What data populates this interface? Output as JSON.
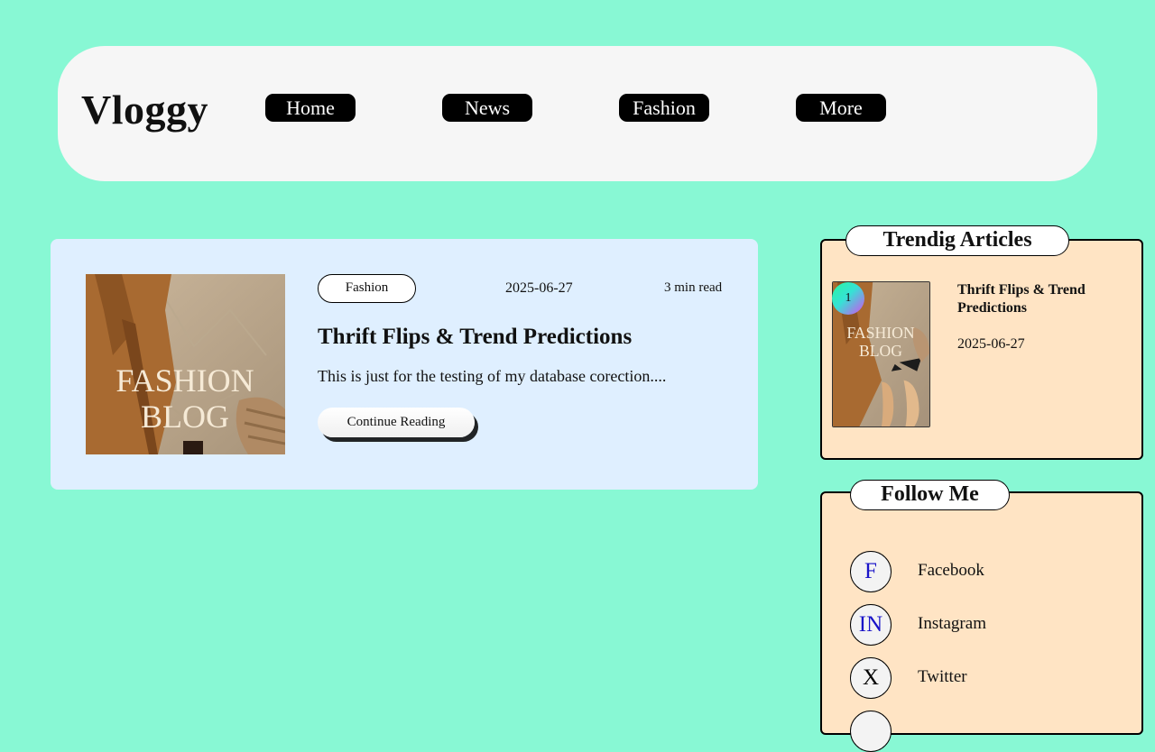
{
  "header": {
    "logo": "Vloggy",
    "nav": [
      "Home",
      "News",
      "Fashion",
      "More"
    ]
  },
  "post": {
    "thumbnail_text": [
      "FASHION",
      "BLOG"
    ],
    "tag": "Fashion",
    "date": "2025-06-27",
    "read_time": "3 min read",
    "title": "Thrift Flips & Trend Predictions",
    "excerpt": "This is just for the testing of my database corection....",
    "cta": "Continue Reading"
  },
  "trending": {
    "title": "Trendig Articles",
    "items": [
      {
        "rank": "1",
        "thumbnail_text": [
          "FASHION",
          "BLOG"
        ],
        "title": "Thrift Flips & Trend Predictions",
        "date": "2025-06-27"
      }
    ]
  },
  "follow": {
    "title": "Follow Me",
    "items": [
      {
        "icon": "F",
        "label": "Facebook",
        "icon_color": "#1a14c8"
      },
      {
        "icon": "IN",
        "label": "Instagram",
        "icon_color": "#1a14c8"
      },
      {
        "icon": "X",
        "label": "Twitter",
        "icon_color": "#000000"
      }
    ]
  },
  "colors": {
    "page_bg": "#88f8d4",
    "header_bg": "#f6f6f6",
    "card_bg": "#dfefff",
    "sidebar_bg": "#ffe4c4",
    "nav_bg": "#000000"
  }
}
